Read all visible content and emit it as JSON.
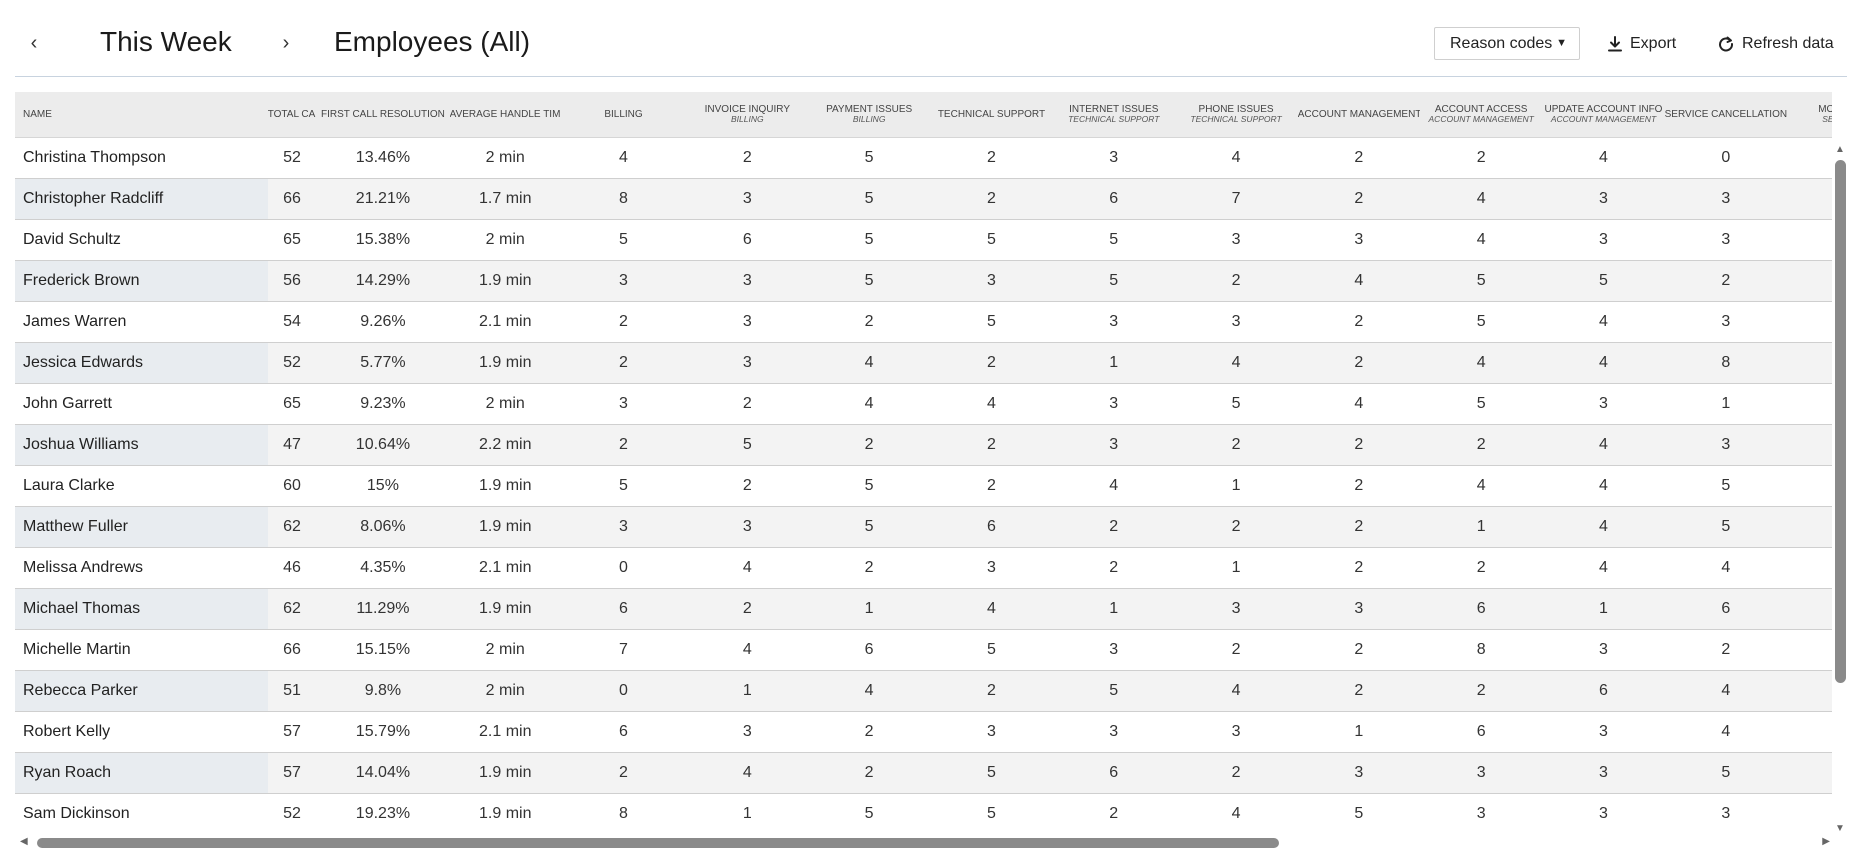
{
  "header": {
    "prev_icon": "‹",
    "next_icon": "›",
    "period": "This Week",
    "scope": "Employees (All)",
    "reason_select": {
      "label": "Reason codes",
      "caret": "▼"
    },
    "export_label": "Export",
    "refresh_label": "Refresh data"
  },
  "table": {
    "columns": [
      {
        "label": "NAME",
        "sub": ""
      },
      {
        "label": "TOTAL CALLS",
        "sub": ""
      },
      {
        "label": "FIRST CALL RESOLUTION",
        "sub": ""
      },
      {
        "label": "AVERAGE HANDLE TIME",
        "sub": ""
      },
      {
        "label": "BILLING",
        "sub": ""
      },
      {
        "label": "INVOICE INQUIRY",
        "sub": "BILLING"
      },
      {
        "label": "PAYMENT ISSUES",
        "sub": "BILLING"
      },
      {
        "label": "TECHNICAL SUPPORT",
        "sub": ""
      },
      {
        "label": "INTERNET ISSUES",
        "sub": "TECHNICAL SUPPORT"
      },
      {
        "label": "PHONE ISSUES",
        "sub": "TECHNICAL SUPPORT"
      },
      {
        "label": "ACCOUNT MANAGEMENT",
        "sub": ""
      },
      {
        "label": "ACCOUNT ACCESS",
        "sub": "ACCOUNT MANAGEMENT"
      },
      {
        "label": "UPDATE ACCOUNT INFO",
        "sub": "ACCOUNT MANAGEMENT"
      },
      {
        "label": "SERVICE CANCELLATION",
        "sub": ""
      },
      {
        "label": "MOVI",
        "sub": "SER"
      }
    ],
    "rows": [
      [
        "Christina Thompson",
        "52",
        "13.46%",
        "2 min",
        "4",
        "2",
        "5",
        "2",
        "3",
        "4",
        "2",
        "2",
        "4",
        "0",
        ""
      ],
      [
        "Christopher Radcliff",
        "66",
        "21.21%",
        "1.7 min",
        "8",
        "3",
        "5",
        "2",
        "6",
        "7",
        "2",
        "4",
        "3",
        "3",
        ""
      ],
      [
        "David Schultz",
        "65",
        "15.38%",
        "2 min",
        "5",
        "6",
        "5",
        "5",
        "5",
        "3",
        "3",
        "4",
        "3",
        "3",
        ""
      ],
      [
        "Frederick Brown",
        "56",
        "14.29%",
        "1.9 min",
        "3",
        "3",
        "5",
        "3",
        "5",
        "2",
        "4",
        "5",
        "5",
        "2",
        ""
      ],
      [
        "James Warren",
        "54",
        "9.26%",
        "2.1 min",
        "2",
        "3",
        "2",
        "5",
        "3",
        "3",
        "2",
        "5",
        "4",
        "3",
        ""
      ],
      [
        "Jessica Edwards",
        "52",
        "5.77%",
        "1.9 min",
        "2",
        "3",
        "4",
        "2",
        "1",
        "4",
        "2",
        "4",
        "4",
        "8",
        ""
      ],
      [
        "John Garrett",
        "65",
        "9.23%",
        "2 min",
        "3",
        "2",
        "4",
        "4",
        "3",
        "5",
        "4",
        "5",
        "3",
        "1",
        ""
      ],
      [
        "Joshua Williams",
        "47",
        "10.64%",
        "2.2 min",
        "2",
        "5",
        "2",
        "2",
        "3",
        "2",
        "2",
        "2",
        "4",
        "3",
        ""
      ],
      [
        "Laura Clarke",
        "60",
        "15%",
        "1.9 min",
        "5",
        "2",
        "5",
        "2",
        "4",
        "1",
        "2",
        "4",
        "4",
        "5",
        ""
      ],
      [
        "Matthew Fuller",
        "62",
        "8.06%",
        "1.9 min",
        "3",
        "3",
        "5",
        "6",
        "2",
        "2",
        "2",
        "1",
        "4",
        "5",
        ""
      ],
      [
        "Melissa Andrews",
        "46",
        "4.35%",
        "2.1 min",
        "0",
        "4",
        "2",
        "3",
        "2",
        "1",
        "2",
        "2",
        "4",
        "4",
        ""
      ],
      [
        "Michael Thomas",
        "62",
        "11.29%",
        "1.9 min",
        "6",
        "2",
        "1",
        "4",
        "1",
        "3",
        "3",
        "6",
        "1",
        "6",
        ""
      ],
      [
        "Michelle Martin",
        "66",
        "15.15%",
        "2 min",
        "7",
        "4",
        "6",
        "5",
        "3",
        "2",
        "2",
        "8",
        "3",
        "2",
        ""
      ],
      [
        "Rebecca Parker",
        "51",
        "9.8%",
        "2 min",
        "0",
        "1",
        "4",
        "2",
        "5",
        "4",
        "2",
        "2",
        "6",
        "4",
        ""
      ],
      [
        "Robert Kelly",
        "57",
        "15.79%",
        "2.1 min",
        "6",
        "3",
        "2",
        "3",
        "3",
        "3",
        "1",
        "6",
        "3",
        "4",
        ""
      ],
      [
        "Ryan Roach",
        "57",
        "14.04%",
        "1.9 min",
        "2",
        "4",
        "2",
        "5",
        "6",
        "2",
        "3",
        "3",
        "3",
        "5",
        ""
      ],
      [
        "Sam Dickinson",
        "52",
        "19.23%",
        "1.9 min",
        "8",
        "1",
        "5",
        "5",
        "2",
        "4",
        "5",
        "3",
        "3",
        "3",
        ""
      ]
    ]
  },
  "scrollbars": {
    "up": "▲",
    "down": "▼",
    "left": "◀",
    "right": "▶"
  },
  "colors": {
    "header_bg": "#ececec",
    "row_alt_bg": "#f3f3f3",
    "name_alt_bg": "#e8ecf0",
    "rule": "#c8d3df",
    "scroll_thumb": "#8a8a8a"
  }
}
